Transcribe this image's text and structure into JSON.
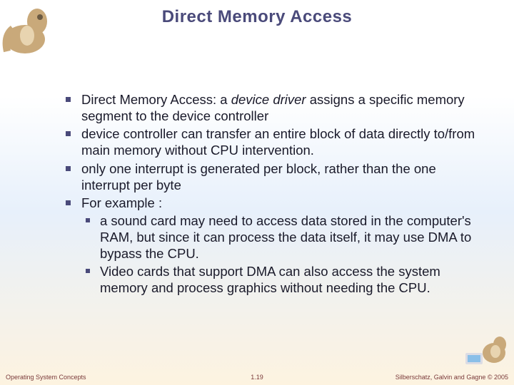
{
  "title": "Direct Memory Access",
  "bullets": {
    "b1_prefix": "Direct Memory Access: a ",
    "b1_em": "device driver",
    "b1_suffix": " assigns a specific memory segment to the device controller",
    "b2": "device controller can transfer an entire block of data directly to/from main memory without CPU intervention.",
    "b3": "only one interrupt is generated per block, rather than the one interrupt per byte",
    "b4": "For example :",
    "b4a": " a sound card may need to access data stored in the computer's RAM, but since it can process the data itself, it may use DMA to bypass the CPU.",
    "b4b": "Video cards that support DMA can also access the system memory and process graphics without needing the CPU."
  },
  "footer": {
    "left": "Operating System Concepts",
    "center": "1.19",
    "right": "Silberschatz, Galvin and Gagne © 2005"
  },
  "icons": {
    "dino_tl": "dinosaur-decoration",
    "dino_br": "dinosaur-computer-decoration"
  }
}
